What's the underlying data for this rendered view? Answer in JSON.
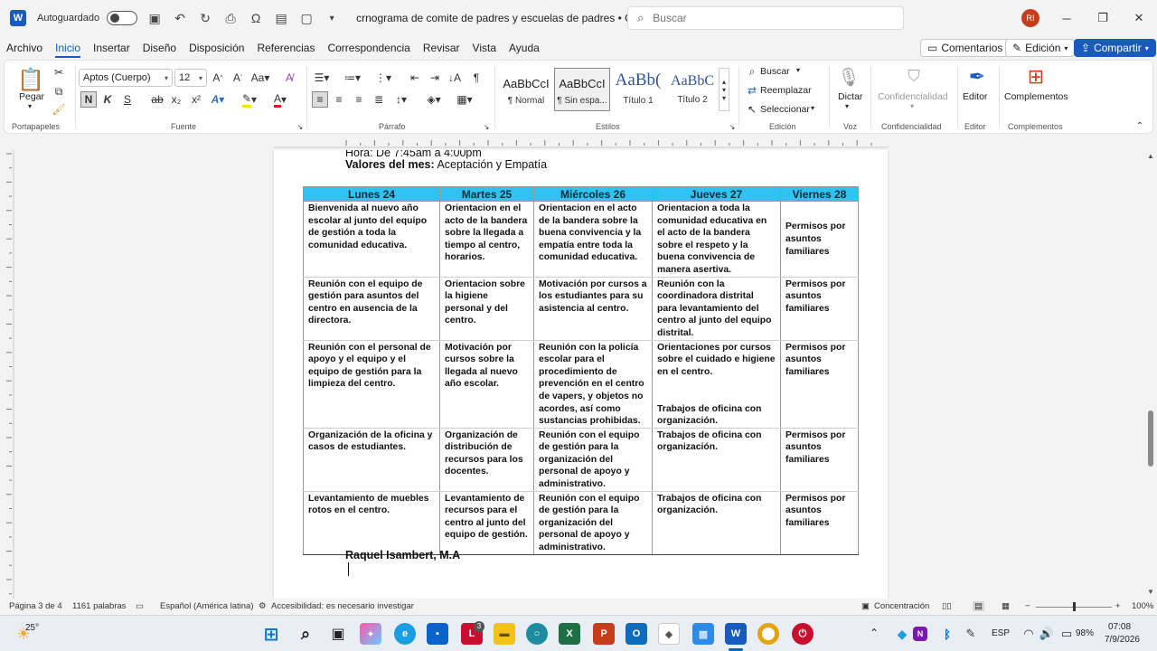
{
  "titlebar": {
    "autosave_label": "Autoguardado",
    "doc_title": "crnograma de comite de padres y escuelas de padres • Guardando...",
    "search_placeholder": "Buscar",
    "avatar_initials": "RI"
  },
  "menu": {
    "items": [
      "Archivo",
      "Inicio",
      "Insertar",
      "Diseño",
      "Disposición",
      "Referencias",
      "Correspondencia",
      "Revisar",
      "Vista",
      "Ayuda"
    ],
    "comments_label": "Comentarios",
    "edit_label": "Edición",
    "share_label": "Compartir"
  },
  "ribbon": {
    "paste_label": "Pegar",
    "clipboard_group": "Portapapeles",
    "font_name": "Aptos (Cuerpo)",
    "font_size": "12",
    "font_group": "Fuente",
    "paragraph_group": "Párrafo",
    "styles": [
      {
        "preview": "AaBbCcI",
        "name": "¶ Normal"
      },
      {
        "preview": "AaBbCcI",
        "name": "¶ Sin espa..."
      },
      {
        "preview": "AaBb(",
        "name": "Título 1"
      },
      {
        "preview": "AaBbC",
        "name": "Título 2"
      }
    ],
    "styles_group": "Estilos",
    "find_label": "Buscar",
    "replace_label": "Reemplazar",
    "select_label": "Seleccionar",
    "editing_group": "Edición",
    "dictate_label": "Dictar",
    "voice_group": "Voz",
    "sensitivity_label": "Confidencialidad",
    "sensitivity_group": "Confidencialidad",
    "editor_label": "Editor",
    "editor_group": "Editor",
    "addins_label": "Complementos",
    "addins_group": "Complementos",
    "bold_glyph": "N",
    "italic_glyph": "K",
    "underline_glyph": "S"
  },
  "document": {
    "top_line": "Hora: De 7:45am a 4:00pm",
    "values_label": "Valores del mes:",
    "values_text": " Aceptación y Empatía",
    "table_headers": [
      "Lunes 24",
      "Martes 25",
      "Miércoles 26",
      "Jueves 27",
      "Viernes 28"
    ],
    "rows": [
      [
        "Bienvenida al nuevo año escolar al junto del equipo de gestión a toda la comunidad educativa.",
        "Orientacion en el acto de la bandera sobre la llegada a tiempo al centro, horarios.",
        "Orientacion en el acto de la bandera sobre la buena convivencia y la empatía entre toda la comunidad educativa.",
        "Orientacion a toda la comunidad educativa en el acto de la bandera sobre el respeto y la buena convivencia de manera asertiva.",
        "Permisos por asuntos familiares"
      ],
      [
        "Reunión con el equipo de gestión para asuntos del centro en ausencia de la directora.",
        "Orientacion sobre la higiene personal y del centro.",
        "Motivación por cursos a los estudiantes para su asistencia al centro.",
        "Reunión con la coordinadora distrital para levantamiento del centro al junto del equipo distrital.",
        "Permisos por asuntos familiares"
      ],
      [
        "Reunión con el personal de apoyo y el equipo y el equipo de gestión para la limpieza del centro.",
        "Motivación por cursos sobre la llegada al nuevo año escolar.",
        "Reunión con la policía escolar para el procedimiento de prevención en el centro de vapers, y objetos no acordes, así como sustancias prohibidas.",
        "Orientaciones por cursos sobre el cuidado e higiene en el centro.",
        "Permisos por asuntos familiares"
      ],
      [
        "Organización de la oficina y casos de estudiantes.",
        "Organización de distribución de recursos para los docentes.",
        "Reunión con el equipo de gestión para la organización del personal de apoyo y administrativo.",
        "Trabajos de oficina con organización.",
        "Permisos por asuntos familiares"
      ],
      [
        "Levantamiento de muebles rotos en el centro.",
        "Levantamiento de recursos para el centro al junto del equipo de gestión.",
        "Reunión con el equipo de gestión para la organización del personal de apoyo y administrativo.",
        "Trabajos de oficina con organización.",
        "Permisos por asuntos familiares"
      ]
    ],
    "row3_extra_jueves": "Trabajos de oficina con organización.",
    "signature": "Raquel Isambert, M.A"
  },
  "statusbar": {
    "page": "Página 3 de 4",
    "words": "1161 palabras",
    "language": "Español (América latina)",
    "accessibility": "Accesibilidad: es necesario investigar",
    "focus": "Concentración",
    "zoom": "100%"
  },
  "taskbar": {
    "weather": "25°",
    "lang": "ESP",
    "battery": "98%",
    "time": "07:08",
    "date": "7/9/2026",
    "badge_count": "3"
  }
}
